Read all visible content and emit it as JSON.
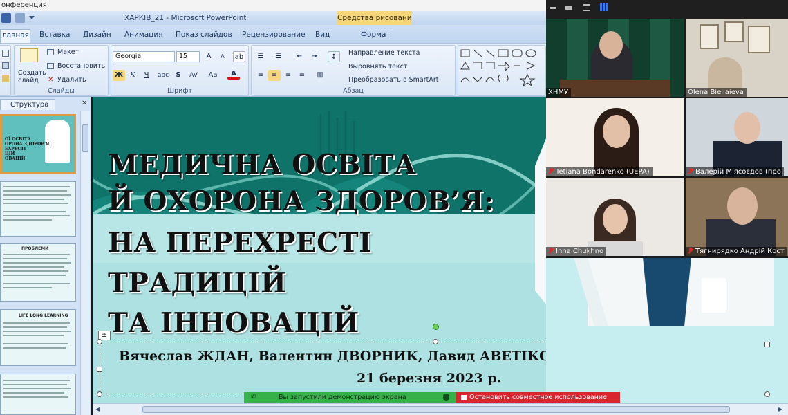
{
  "zoom_title": "онференция",
  "window": {
    "quick_icons": [
      "undo-icon",
      "redo-icon"
    ],
    "title": "ХАРКІВ_21  -  Microsoft PowerPoint",
    "context_tool": "Средства рисования"
  },
  "ribbon_tabs": [
    "лавная",
    "Вставка",
    "Дизайн",
    "Анимация",
    "Показ слайдов",
    "Рецензирование",
    "Вид",
    "Формат"
  ],
  "ribbon": {
    "slides": {
      "new_slide": "Создать слайд",
      "layout": "Макет",
      "reset": "Восстановить",
      "delete": "Удалить",
      "label": "Слайды"
    },
    "font": {
      "family": "Georgia",
      "size": "15",
      "bold": "Ж",
      "italic": "К",
      "underline": "Ч",
      "strike": "abc",
      "shadow": "S",
      "spacing": "AV",
      "case": "Aa",
      "color_letter": "A",
      "label": "Шрифт"
    },
    "paragraph": {
      "direction": "Направление текста",
      "align": "Выровнять текст",
      "smartart": "Преобразовать в SmartArt",
      "label": "Абзац"
    }
  },
  "outline_tab": "Структура",
  "slide": {
    "title_lines": [
      "МЕДИЧНА ОСВІТА",
      "Й ОХОРОНА ЗДОРОВ’Я:",
      "НА ПЕРЕХРЕСТІ",
      "ТРАДИЦІЙ",
      "ТА ІННОВАЦІЙ"
    ],
    "authors": "Вячеслав ЖДАН, Валентин ДВОРНИК, Давид АВЕТІКОВ, Олена БЄЛЯЄВА",
    "date": "21 березня 2023 р."
  },
  "thumb1_text": "ОЇ ОСВІТА\nОРОНА ЗДОРОВ'Я:\nЕХРЕСТІ\nЦІЙ\nОВАЦІЙ",
  "thumb3_text": "ПРОБЛЕМИ",
  "thumb4_text": "LIFE LONG LEARNING",
  "participants": [
    {
      "name": "ХНМУ",
      "muted": false
    },
    {
      "name": "Olena Bieliaieva",
      "muted": false
    },
    {
      "name": "Tetiana Bondarenko (UEPA)",
      "muted": true
    },
    {
      "name": "Валерій М'ясоєдов (про",
      "muted": true
    },
    {
      "name": "Inna Chukhno",
      "muted": true
    },
    {
      "name": "Тягнирядко Андрій Кост",
      "muted": true
    }
  ],
  "share": {
    "status": "Вы запустили демонстрацию экрана",
    "stop": "Остановить совместное использование"
  },
  "colors": {
    "teal_bg": "#b9e6e6",
    "teal_dark": "#0d7a72",
    "share_green": "#36b14a",
    "share_red": "#d9262e",
    "ribbon_blue": "#cfe0f5"
  }
}
